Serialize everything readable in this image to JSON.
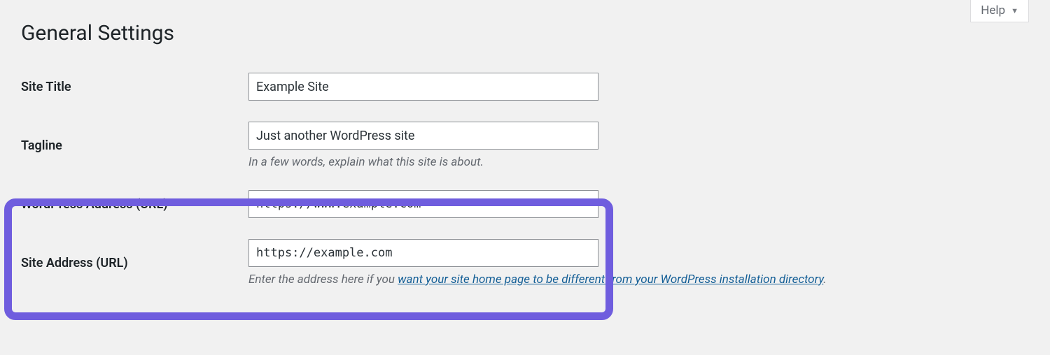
{
  "help": {
    "label": "Help"
  },
  "page": {
    "title": "General Settings"
  },
  "fields": {
    "site_title": {
      "label": "Site Title",
      "value": "Example Site"
    },
    "tagline": {
      "label": "Tagline",
      "value": "Just another WordPress site",
      "description": "In a few words, explain what this site is about."
    },
    "wp_url": {
      "label": "WordPress Address (URL)",
      "value": "https://www.example.com"
    },
    "site_url": {
      "label": "Site Address (URL)",
      "value": "https://example.com",
      "description_pre": "Enter the address here if you ",
      "description_link": "want your site home page to be different from your WordPress installation directory",
      "description_post": "."
    }
  }
}
